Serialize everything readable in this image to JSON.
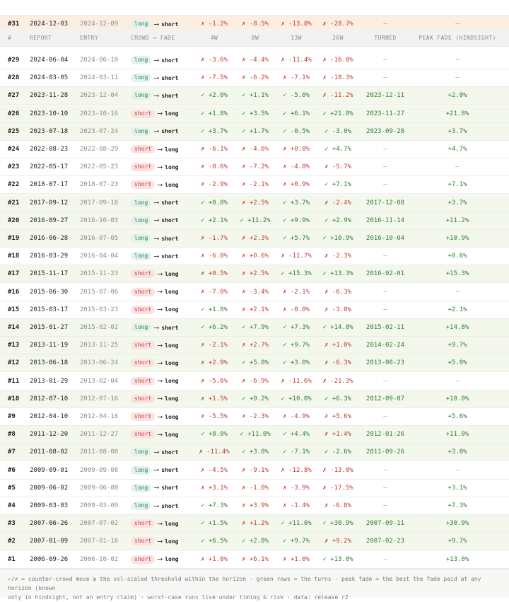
{
  "header": {
    "id": "#",
    "report": "REPORT",
    "entry": "ENTRY",
    "crowd_fade": "CROWD ⟶ FADE",
    "h4": "4W",
    "h8": "8W",
    "h13": "13W",
    "h26": "26W",
    "turned": "TURNED",
    "peak": "PEAK FADE (HINDSIGHT)"
  },
  "current": {
    "id": "#31",
    "report": "2024-12-03",
    "entry": "2024-12-09",
    "crowd": "long",
    "fade": "short",
    "h4": "✗ -1.2%",
    "h8": "✗ -8.5%",
    "h13": "✗ -13.8%",
    "h26": "✗ -28.7%",
    "turned": "—",
    "peak": "—"
  },
  "rows": [
    {
      "id": "#29",
      "report": "2024-06-04",
      "entry": "2024-06-10",
      "crowd": "long",
      "fade": "short",
      "h4": "✗ -3.6%",
      "h8": "✗ -4.4%",
      "h13": "✗ -11.4%",
      "h26": "✗ -16.0%",
      "turned": "—",
      "peak": "—",
      "green": false
    },
    {
      "id": "#28",
      "report": "2024-03-05",
      "entry": "2024-03-11",
      "crowd": "long",
      "fade": "short",
      "h4": "✗ -7.5%",
      "h8": "✗ -6.2%",
      "h13": "✗ -7.1%",
      "h26": "✗ -18.3%",
      "turned": "—",
      "peak": "—",
      "green": false
    },
    {
      "id": "#27",
      "report": "2023-11-28",
      "entry": "2023-12-04",
      "crowd": "long",
      "fade": "short",
      "h4": "✓ +2.0%",
      "h8": "✓ +1.1%",
      "h13": "✓ -5.0%",
      "h26": "✗ -11.2%",
      "turned": "2023-12-11",
      "peak": "+2.0%",
      "green": true
    },
    {
      "id": "#26",
      "report": "2023-10-10",
      "entry": "2023-10-16",
      "crowd": "short",
      "fade": "long",
      "h4": "✓ +1.8%",
      "h8": "✓ +3.5%",
      "h13": "✓ +6.1%",
      "h26": "✓ +21.8%",
      "turned": "2023-11-27",
      "peak": "+21.8%",
      "green": true
    },
    {
      "id": "#25",
      "report": "2023-07-18",
      "entry": "2023-07-24",
      "crowd": "long",
      "fade": "short",
      "h4": "✓ +3.7%",
      "h8": "✓ +1.7%",
      "h13": "✓ -0.5%",
      "h26": "✓ -3.0%",
      "turned": "2023-09-28",
      "peak": "+3.7%",
      "green": true
    },
    {
      "id": "#24",
      "report": "2022-08-23",
      "entry": "2022-08-29",
      "crowd": "short",
      "fade": "long",
      "h4": "✗ -6.1%",
      "h8": "✗ -4.6%",
      "h13": "✗ +0.8%",
      "h26": "✓ +4.7%",
      "turned": "—",
      "peak": "+4.7%",
      "green": false
    },
    {
      "id": "#23",
      "report": "2022-05-17",
      "entry": "2022-05-23",
      "crowd": "short",
      "fade": "long",
      "h4": "✗ -0.6%",
      "h8": "✗ -7.2%",
      "h13": "✗ -4.8%",
      "h26": "✗ -5.7%",
      "turned": "—",
      "peak": "—",
      "green": false
    },
    {
      "id": "#22",
      "report": "2018-07-17",
      "entry": "2018-07-23",
      "crowd": "short",
      "fade": "long",
      "h4": "✗ -2.9%",
      "h8": "✗ -2.1%",
      "h13": "✗ +0.9%",
      "h26": "✓ +7.1%",
      "turned": "—",
      "peak": "+7.1%",
      "green": false
    },
    {
      "id": "#21",
      "report": "2017-09-12",
      "entry": "2017-09-18",
      "crowd": "long",
      "fade": "short",
      "h4": "✓ +0.8%",
      "h8": "✗ +2.5%",
      "h13": "✓ +3.7%",
      "h26": "✗ -2.4%",
      "turned": "2017-12-08",
      "peak": "+3.7%",
      "green": true
    },
    {
      "id": "#20",
      "report": "2016-09-27",
      "entry": "2016-10-03",
      "crowd": "long",
      "fade": "short",
      "h4": "✓ +2.1%",
      "h8": "✓ +11.2%",
      "h13": "✓ +9.9%",
      "h26": "✓ +2.9%",
      "turned": "2016-11-14",
      "peak": "+11.2%",
      "green": true
    },
    {
      "id": "#19",
      "report": "2016-06-28",
      "entry": "2016-07-05",
      "crowd": "long",
      "fade": "short",
      "h4": "✗ -1.7%",
      "h8": "✗ +2.3%",
      "h13": "✓ +5.7%",
      "h26": "✓ +10.9%",
      "turned": "2016-10-04",
      "peak": "+10.9%",
      "green": true
    },
    {
      "id": "#18",
      "report": "2016-03-29",
      "entry": "2016-04-04",
      "crowd": "long",
      "fade": "short",
      "h4": "✗ -6.0%",
      "h8": "✗ +0.6%",
      "h13": "✗ -11.7%",
      "h26": "✗ -2.3%",
      "turned": "—",
      "peak": "+0.6%",
      "green": false
    },
    {
      "id": "#17",
      "report": "2015-11-17",
      "entry": "2015-11-23",
      "crowd": "short",
      "fade": "long",
      "h4": "✗ +0.5%",
      "h8": "✗ +2.5%",
      "h13": "✓ +15.3%",
      "h26": "✓ +13.3%",
      "turned": "2016-02-01",
      "peak": "+15.3%",
      "green": true
    },
    {
      "id": "#16",
      "report": "2015-06-30",
      "entry": "2015-07-06",
      "crowd": "short",
      "fade": "long",
      "h4": "✗ -7.0%",
      "h8": "✗ -3.4%",
      "h13": "✗ -2.1%",
      "h26": "✗ -6.3%",
      "turned": "—",
      "peak": "—",
      "green": false
    },
    {
      "id": "#15",
      "report": "2015-03-17",
      "entry": "2015-03-23",
      "crowd": "short",
      "fade": "long",
      "h4": "✓ +1.8%",
      "h8": "✗ +2.1%",
      "h13": "✗ -0.8%",
      "h26": "✗ -3.0%",
      "turned": "—",
      "peak": "+2.1%",
      "green": false
    },
    {
      "id": "#14",
      "report": "2015-01-27",
      "entry": "2015-02-02",
      "crowd": "long",
      "fade": "short",
      "h4": "✓ +6.2%",
      "h8": "✓ +7.9%",
      "h13": "✓ +7.3%",
      "h26": "✓ +14.8%",
      "turned": "2015-02-11",
      "peak": "+14.8%",
      "green": true
    },
    {
      "id": "#13",
      "report": "2013-11-19",
      "entry": "2013-11-25",
      "crowd": "short",
      "fade": "long",
      "h4": "✗ -2.1%",
      "h8": "✗ +2.7%",
      "h13": "✓ +9.7%",
      "h26": "✗ +1.0%",
      "turned": "2014-02-24",
      "peak": "+9.7%",
      "green": true
    },
    {
      "id": "#12",
      "report": "2013-06-18",
      "entry": "2013-06-24",
      "crowd": "short",
      "fade": "long",
      "h4": "✗ +2.9%",
      "h8": "✓ +5.8%",
      "h13": "✓ +3.0%",
      "h26": "✗ -6.3%",
      "turned": "2013-08-23",
      "peak": "+5.8%",
      "green": true
    },
    {
      "id": "#11",
      "report": "2013-01-29",
      "entry": "2013-02-04",
      "crowd": "short",
      "fade": "long",
      "h4": "✗ -5.6%",
      "h8": "✗ -6.9%",
      "h13": "✗ -11.6%",
      "h26": "✗ -21.3%",
      "turned": "—",
      "peak": "—",
      "green": false
    },
    {
      "id": "#10",
      "report": "2012-07-10",
      "entry": "2012-07-16",
      "crowd": "short",
      "fade": "long",
      "h4": "✗ +1.5%",
      "h8": "✓ +9.2%",
      "h13": "✓ +10.0%",
      "h26": "✓ +6.3%",
      "turned": "2012-09-07",
      "peak": "+10.0%",
      "green": true
    },
    {
      "id": "#9",
      "report": "2012-04-10",
      "entry": "2012-04-16",
      "crowd": "short",
      "fade": "long",
      "h4": "✗ -5.5%",
      "h8": "✗ -2.3%",
      "h13": "✗ -4.9%",
      "h26": "✗ +5.6%",
      "turned": "—",
      "peak": "+5.6%",
      "green": false
    },
    {
      "id": "#8",
      "report": "2011-12-20",
      "entry": "2011-12-27",
      "crowd": "short",
      "fade": "long",
      "h4": "✓ +8.0%",
      "h8": "✓ +11.0%",
      "h13": "✓ +4.4%",
      "h26": "✗ +1.4%",
      "turned": "2012-01-26",
      "peak": "+11.0%",
      "green": true
    },
    {
      "id": "#7",
      "report": "2011-08-02",
      "entry": "2011-08-08",
      "crowd": "long",
      "fade": "short",
      "h4": "✗ -11.4%",
      "h8": "✓ +3.8%",
      "h13": "✓ -7.1%",
      "h26": "✓ -2.6%",
      "turned": "2011-09-26",
      "peak": "+3.8%",
      "green": true
    },
    {
      "id": "#6",
      "report": "2009-09-01",
      "entry": "2009-09-08",
      "crowd": "long",
      "fade": "short",
      "h4": "✗ -4.5%",
      "h8": "✗ -9.1%",
      "h13": "✗ -12.8%",
      "h26": "✗ -13.0%",
      "turned": "—",
      "peak": "—",
      "green": false
    },
    {
      "id": "#5",
      "report": "2009-06-02",
      "entry": "2009-06-08",
      "crowd": "long",
      "fade": "short",
      "h4": "✗ +3.1%",
      "h8": "✗ -1.0%",
      "h13": "✗ -3.9%",
      "h26": "✗ -17.5%",
      "turned": "—",
      "peak": "+3.1%",
      "green": false
    },
    {
      "id": "#4",
      "report": "2009-03-03",
      "entry": "2009-03-09",
      "crowd": "long",
      "fade": "short",
      "h4": "✓ +7.3%",
      "h8": "✗ +3.9%",
      "h13": "✗ -1.4%",
      "h26": "✗ -6.8%",
      "turned": "—",
      "peak": "+7.3%",
      "green": false
    },
    {
      "id": "#3",
      "report": "2007-06-26",
      "entry": "2007-07-02",
      "crowd": "short",
      "fade": "long",
      "h4": "✓ +1.5%",
      "h8": "✗ +1.2%",
      "h13": "✓ +11.0%",
      "h26": "✓ +30.9%",
      "turned": "2007-09-11",
      "peak": "+30.9%",
      "green": true
    },
    {
      "id": "#2",
      "report": "2007-01-09",
      "entry": "2007-01-16",
      "crowd": "short",
      "fade": "long",
      "h4": "✓ +6.5%",
      "h8": "✓ +2.8%",
      "h13": "✓ +9.7%",
      "h26": "✗ +9.2%",
      "turned": "2007-02-23",
      "peak": "+9.7%",
      "green": true
    },
    {
      "id": "#1",
      "report": "2006-09-26",
      "entry": "2006-10-02",
      "crowd": "short",
      "fade": "long",
      "h4": "✗ +1.0%",
      "h8": "✗ +6.1%",
      "h13": "✗ +1.0%",
      "h26": "✓ +13.0%",
      "turned": "—",
      "peak": "+13.0%",
      "green": false
    }
  ],
  "footer": {
    "line1": "✓/✗ = counter-crowd move ≷ the vol-scaled threshold within the horizon · green rows = the turns · peak fade = the best the fade paid at any horizon (known",
    "line2": "only in hindsight, not an entry claim) · worst-case runs live under timing & risk · data: release r2"
  },
  "colors": {
    "good": "#2f7d3a",
    "bad": "#c23b32",
    "green_row": "#f3f7ec",
    "current_row": "#fcefe2"
  }
}
